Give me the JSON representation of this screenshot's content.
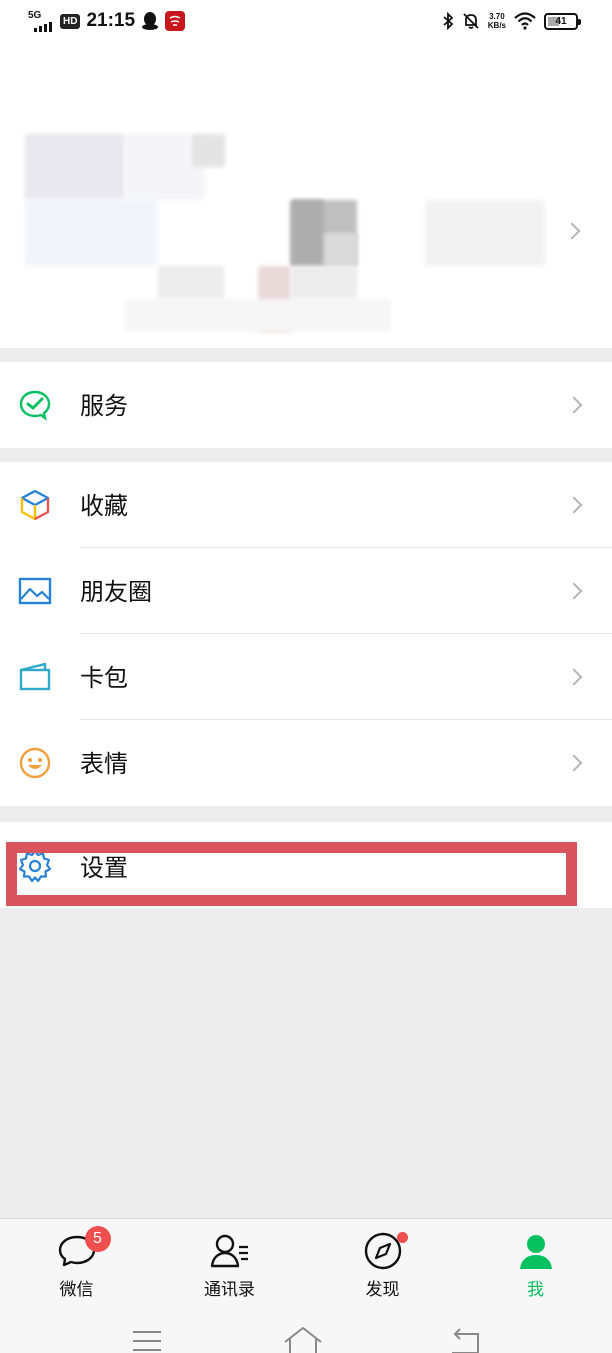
{
  "status_bar": {
    "network": "5G",
    "hd": "HD",
    "time": "21:15",
    "app_badge_icon": "app-notification-icon",
    "speed_value": "3.70",
    "speed_unit": "KB/s",
    "battery": "41",
    "battery_level": 0.41
  },
  "profile": {
    "name_obscured": true
  },
  "menu": {
    "services": {
      "label": "服务",
      "icon": "wechat-pay-icon",
      "color": "#07c160"
    },
    "favorites": {
      "label": "收藏",
      "icon": "cube-icon"
    },
    "moments": {
      "label": "朋友圈",
      "icon": "picture-icon",
      "color": "#2782d7"
    },
    "cards": {
      "label": "卡包",
      "icon": "card-icon",
      "color": "#2782d7"
    },
    "stickers": {
      "label": "表情",
      "icon": "smiley-icon",
      "color": "#f0a03c"
    },
    "settings": {
      "label": "设置",
      "icon": "gear-icon",
      "color": "#2782d7"
    }
  },
  "tabbar": {
    "tabs": [
      {
        "label": "微信",
        "icon": "chat-bubble-icon",
        "badge": "5"
      },
      {
        "label": "通讯录",
        "icon": "contacts-icon"
      },
      {
        "label": "发现",
        "icon": "compass-icon",
        "has_dot": true
      },
      {
        "label": "我",
        "icon": "person-icon",
        "active": true
      }
    ],
    "active_color": "#07c160"
  },
  "system_nav": {
    "icons": [
      "menu-icon",
      "home-icon",
      "back-icon"
    ]
  },
  "highlight": {
    "target": "settings",
    "color": "#d9545c"
  }
}
